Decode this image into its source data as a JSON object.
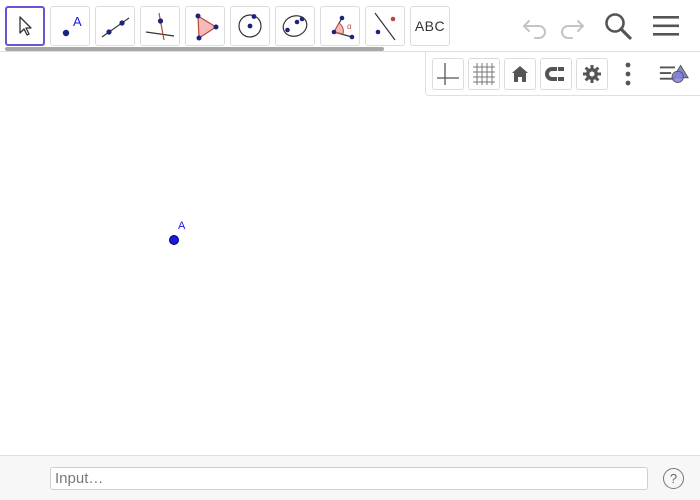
{
  "toolbar": {
    "tools": [
      {
        "id": "move",
        "icon": "pointer-arrow-icon",
        "selected": true
      },
      {
        "id": "point",
        "icon": "point-icon",
        "label": "A"
      },
      {
        "id": "line",
        "icon": "line-through-points-icon"
      },
      {
        "id": "perpendicular",
        "icon": "perpendicular-line-icon"
      },
      {
        "id": "polygon",
        "icon": "polygon-icon"
      },
      {
        "id": "circle",
        "icon": "circle-center-point-icon"
      },
      {
        "id": "conic",
        "icon": "conic-icon"
      },
      {
        "id": "angle",
        "icon": "angle-icon",
        "label": "α"
      },
      {
        "id": "reflect",
        "icon": "reflect-about-line-icon"
      },
      {
        "id": "text",
        "icon": "text-tool-icon",
        "label": "ABC"
      }
    ],
    "right_buttons": [
      "undo-icon",
      "redo-icon",
      "search-icon",
      "menu-icon"
    ]
  },
  "style_bar": {
    "buttons": [
      "axes-icon",
      "grid-icon",
      "home-icon",
      "magnet-icon",
      "gear-icon",
      "more-vertical-icon",
      "toggle-style-bar-icon"
    ]
  },
  "graphics": {
    "points": [
      {
        "label": "A",
        "color": "#1b1bd8"
      }
    ]
  },
  "input_bar": {
    "placeholder": "Input…",
    "help_label": "?"
  },
  "colors": {
    "accent": "#6557d2",
    "point": "#1b1bd8",
    "tool_icon_blue": "#1a237e",
    "tool_fill_pink": "#f4b9b9"
  }
}
